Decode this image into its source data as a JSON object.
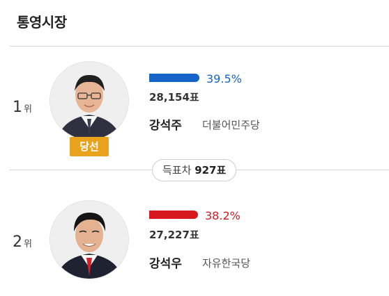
{
  "title": "통영시장",
  "candidates": [
    {
      "rank": "1",
      "rank_unit": "위",
      "percent": 39.5,
      "percent_label": "39.5%",
      "votes": "28,154",
      "vote_unit": "표",
      "name": "강석주",
      "party": "더불어민주당",
      "badge": "당선",
      "bar_color": "#1565c8",
      "text_color": "#1565c8"
    },
    {
      "rank": "2",
      "rank_unit": "위",
      "percent": 38.2,
      "percent_label": "38.2%",
      "votes": "27,227",
      "vote_unit": "표",
      "name": "강석우",
      "party": "자유한국당",
      "bar_color": "#d7191f",
      "text_color": "#d7191f"
    }
  ],
  "difference": {
    "label": "득표차",
    "value": "927",
    "unit": "표"
  }
}
